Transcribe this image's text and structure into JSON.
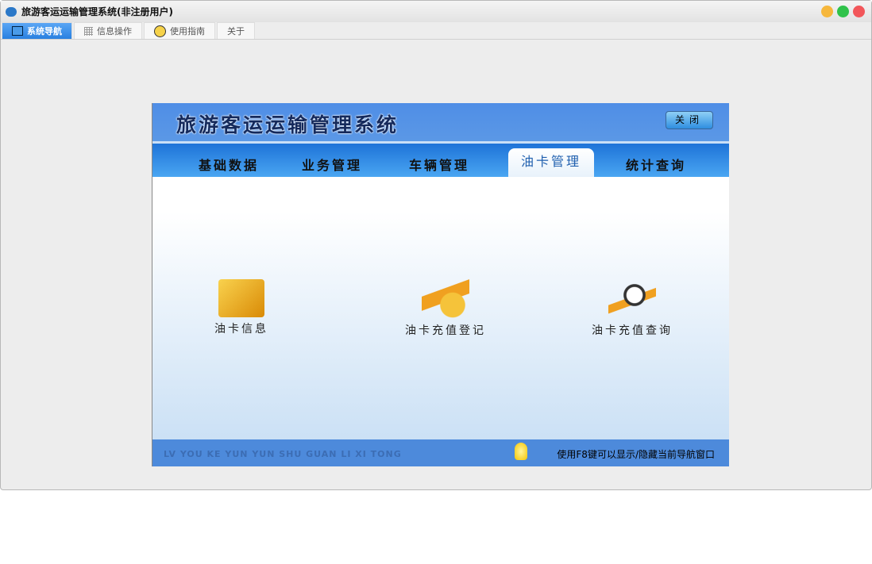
{
  "window": {
    "title": "旅游客运运输管理系统(非注册用户)"
  },
  "tabs": [
    {
      "label": "系统导航"
    },
    {
      "label": "信息操作"
    },
    {
      "label": "使用指南"
    },
    {
      "label": "关于"
    }
  ],
  "panel": {
    "title": "旅游客运运输管理系统",
    "close_label": "关闭",
    "nav": [
      {
        "label": "基础数据"
      },
      {
        "label": "业务管理"
      },
      {
        "label": "车辆管理"
      },
      {
        "label": "油卡管理"
      },
      {
        "label": "统计查询"
      }
    ],
    "items": [
      {
        "label": "油卡信息"
      },
      {
        "label": "油卡充值登记"
      },
      {
        "label": "油卡充值查询"
      }
    ],
    "footer_en": "LV YOU KE YUN YUN SHU GUAN LI XI TONG",
    "footer_tip": "使用F8键可以显示/隐藏当前导航窗口"
  }
}
